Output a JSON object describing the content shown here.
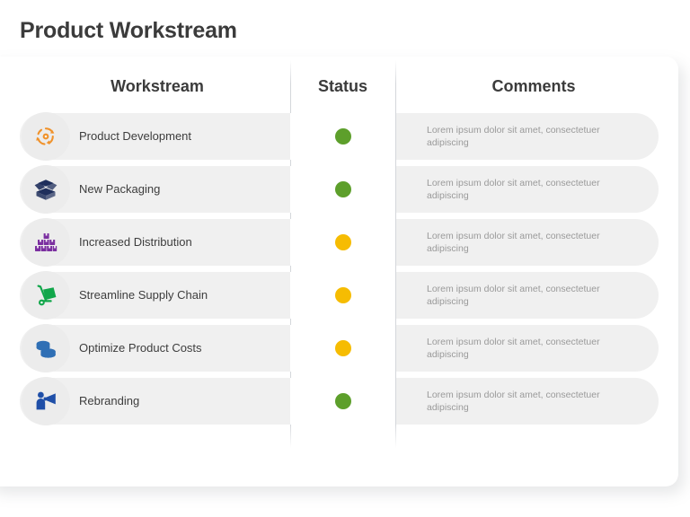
{
  "page": {
    "title": "Product Workstream"
  },
  "columns": {
    "workstream": "Workstream",
    "status": "Status",
    "comments": "Comments"
  },
  "colors": {
    "green": "#5d9f2b",
    "yellow": "#f6bc02",
    "title": "#3b3b3b",
    "pill": "#f0f0f0",
    "icon_circle": "#ececec",
    "comment_text": "#9a9a9a",
    "icon_product_development": "#f0922b",
    "icon_new_packaging": "#1f2f5c",
    "icon_increased_distribution": "#7b2fa0",
    "icon_streamline_supply_chain": "#11a64a",
    "icon_optimize_product_costs": "#2f6fb5",
    "icon_rebranding": "#1f4fa8"
  },
  "rows": [
    {
      "label": "Product Development",
      "icon": "cycle-arrows-icon",
      "status": "green",
      "comment": "Lorem ipsum dolor sit amet, consectetuer adipiscing"
    },
    {
      "label": "New Packaging",
      "icon": "open-box-icon",
      "status": "green",
      "comment": "Lorem ipsum dolor sit amet, consectetuer adipiscing"
    },
    {
      "label": "Increased Distribution",
      "icon": "stacked-boxes-icon",
      "status": "yellow",
      "comment": "Lorem ipsum dolor sit amet, consectetuer adipiscing"
    },
    {
      "label": "Streamline Supply Chain",
      "icon": "hand-truck-icon",
      "status": "yellow",
      "comment": "Lorem ipsum dolor sit amet, consectetuer adipiscing"
    },
    {
      "label": "Optimize Product Costs",
      "icon": "coin-stack-icon",
      "status": "yellow",
      "comment": "Lorem ipsum dolor sit amet, consectetuer adipiscing"
    },
    {
      "label": "Rebranding",
      "icon": "megaphone-person-icon",
      "status": "green",
      "comment": "Lorem ipsum dolor sit amet, consectetuer adipiscing"
    }
  ]
}
